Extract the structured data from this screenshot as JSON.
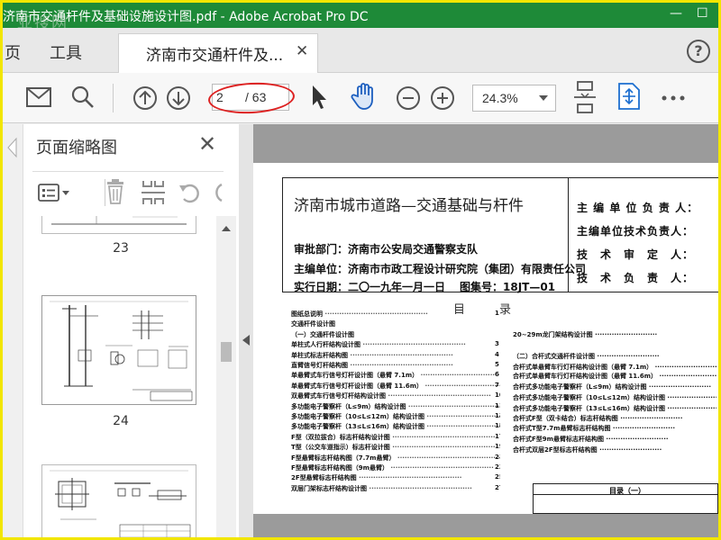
{
  "window": {
    "title": "济南市交通杆件及基础设施设计图.pdf - Adobe Acrobat Pro DC",
    "watermark": "亚搜网",
    "minimize": "—",
    "maximize": "☐"
  },
  "tabs": {
    "home_partial": "页",
    "tools": "工具",
    "document": "济南市交通杆件及...",
    "close": "✕",
    "help": "?"
  },
  "toolbar": {
    "current_page": "2",
    "page_total": "/ 63",
    "zoom": "24.3%"
  },
  "thumbnails": {
    "title": "页面缩略图",
    "close": "✕",
    "pages": [
      "23",
      "24"
    ]
  },
  "document": {
    "title": "济南市城市道路—交通基础与杆件",
    "approver": "审批部门：济南市公安局交通警察支队",
    "editor": "主编单位：济南市市政工程设计研究院（集团）有限责任公司",
    "date": "实行日期：二〇一九年一月一日",
    "atlas_no": "图集号：18JT—01",
    "right_labels": [
      "主 编 单 位 负 责 人：",
      "主编单位技术负责人：",
      "技　术　审　定　人：",
      "技　术　负　责　人："
    ],
    "toc_heading": "目　　录",
    "toc_left": [
      {
        "text": "图纸总说明",
        "page": "1"
      },
      {
        "text": "交通杆件设计图",
        "page": ""
      },
      {
        "text": "（一）交通杆件设计图",
        "page": ""
      },
      {
        "text": "单柱式人行杆结构设计图",
        "page": "3"
      },
      {
        "text": "单柱式标志杆结构图",
        "page": "4"
      },
      {
        "text": "直臂信号灯杆结构图",
        "page": "5"
      },
      {
        "text": "单悬臂式车行信号灯杆设计图（悬臂 7.1m）",
        "page": "6"
      },
      {
        "text": "单悬臂式车行信号灯杆设计图（悬臂 11.6m）",
        "page": "7"
      },
      {
        "text": "双悬臂式车行信号灯杆结构设计图",
        "page": "10"
      },
      {
        "text": "多功能电子警察杆（L≤9m）结构设计图",
        "page": "11"
      },
      {
        "text": "多功能电子警察杆（10≤L≤12m）结构设计图",
        "page": "13"
      },
      {
        "text": "多功能电子警察杆（13≤L≤16m）结构设计图",
        "page": "15"
      },
      {
        "text": "F型（双拉拔合）标志杆结构设计图",
        "page": "17"
      },
      {
        "text": "T型（公交车道指示）标志杆设计图",
        "page": "19"
      },
      {
        "text": "F型悬臂标志杆结构图（7.7m悬臂）",
        "page": "21"
      },
      {
        "text": "F型悬臂标志杆结构图（9m悬臂）",
        "page": "23"
      },
      {
        "text": "2F型悬臂标志杆结构图",
        "page": "25"
      },
      {
        "text": "双层门架标志杆结构设计图",
        "page": "27"
      }
    ],
    "toc_right": [
      "20~29m龙门架结构设计图",
      "（二）合杆式交通杆件设计图",
      "合杆式单悬臂车行灯杆结构设计图（悬臂 7.1m）",
      "合杆式单悬臂车行灯杆结构设计图（悬臂 11.6m）",
      "合杆式多功能电子警察杆（L≤9m）结构设计图",
      "合杆式多功能电子警察杆（10≤L≤12m）结构设计图",
      "合杆式多功能电子警察杆（13≤L≤16m）结构设计图",
      "合杆式F型（双卡结合）标志杆结构图",
      "合杆式T型7.7m悬臂标志杆结构图",
      "合杆式F型9m悬臂标志杆结构图",
      "合杆式双层2F型标志杆结构图"
    ],
    "stamp_title": "目录（一）"
  }
}
